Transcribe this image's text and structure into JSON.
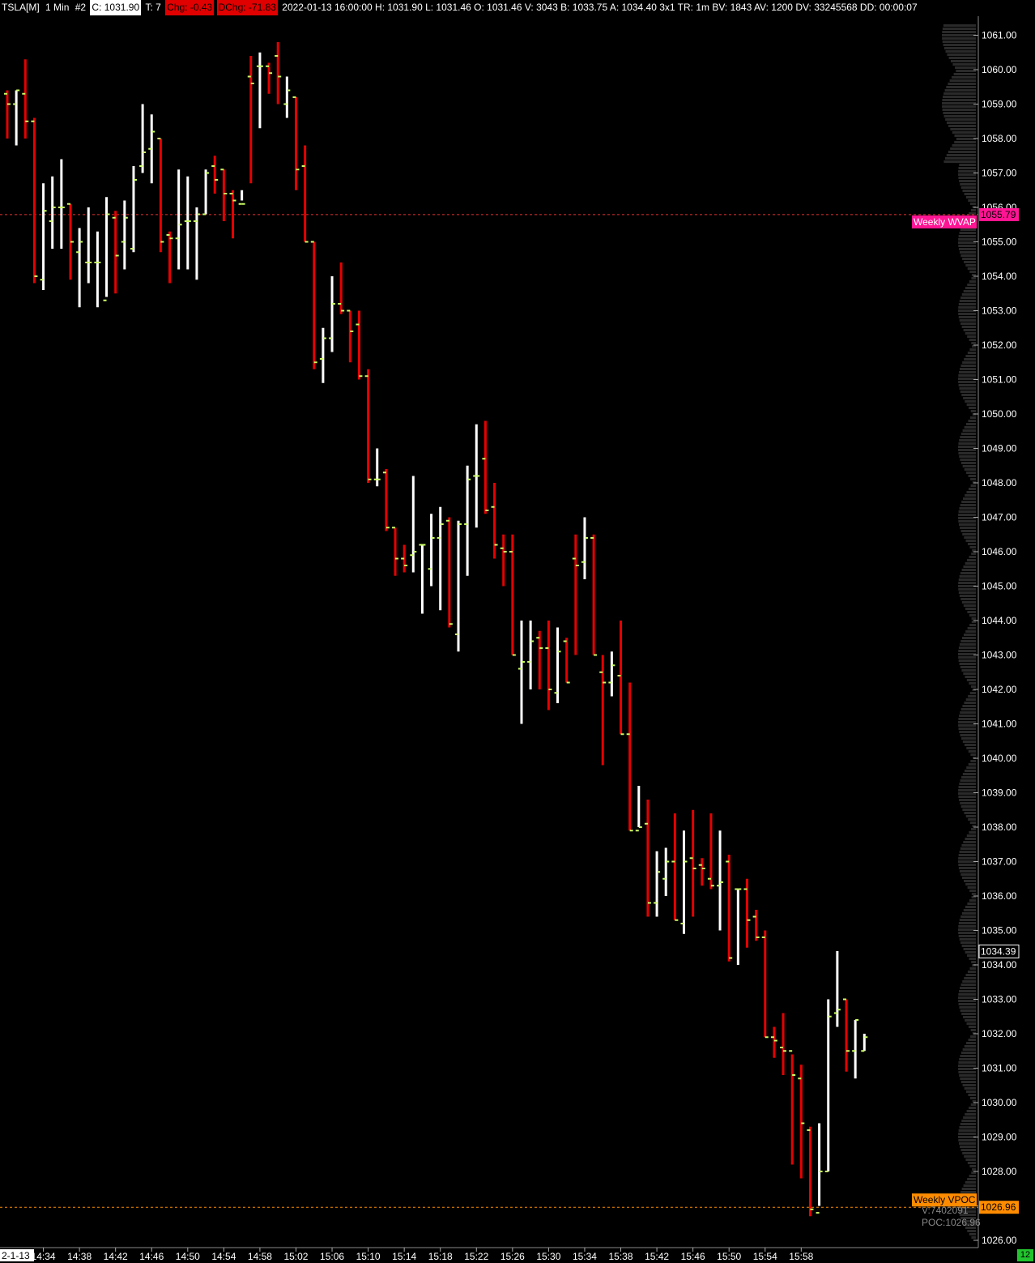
{
  "header": {
    "symbol": "TSLA[M]",
    "timeframe": "1 Min",
    "chart_num": "#2",
    "close": "C: 1031.90",
    "ticks": "T: 7",
    "chg": "Chg: -0.43",
    "dchg": "DChg: -71.83",
    "info": "2022-01-13 16:00:00 H: 1031.90 L: 1031.46 O: 1031.46 V: 3043 B: 1033.75 A: 1034.40 3x1 TR: 1m BV: 1843 AV: 1200 DV: 33245568 DD: 00:00:07"
  },
  "date_label": "2-1-13",
  "badge": "12",
  "colors": {
    "up": "#ffffff",
    "down": "#e60000",
    "close_tick": "#ccff66",
    "wvap": "#ff1493",
    "vpoc": "#ff8c00"
  },
  "chart_data": {
    "type": "ohlc",
    "ylim": [
      1025.8,
      1061.6
    ],
    "yticks": [
      1026,
      1027,
      1028,
      1029,
      1030,
      1031,
      1032,
      1033,
      1034,
      1035,
      1036,
      1037,
      1038,
      1039,
      1040,
      1041,
      1042,
      1043,
      1044,
      1045,
      1046,
      1047,
      1048,
      1049,
      1050,
      1051,
      1052,
      1053,
      1054,
      1055,
      1056,
      1057,
      1058,
      1059,
      1060,
      1061
    ],
    "xticks": [
      "14:34",
      "14:38",
      "14:42",
      "14:46",
      "14:50",
      "14:54",
      "14:58",
      "15:02",
      "15:06",
      "15:10",
      "15:14",
      "15:18",
      "15:22",
      "15:26",
      "15:30",
      "15:34",
      "15:38",
      "15:42",
      "15:46",
      "15:50",
      "15:54",
      "15:58"
    ],
    "bars": [
      {
        "o": 1059.3,
        "h": 1059.4,
        "l": 1058.0,
        "c": 1059.0
      },
      {
        "o": 1059.0,
        "h": 1059.4,
        "l": 1057.8,
        "c": 1059.4
      },
      {
        "o": 1059.3,
        "h": 1060.3,
        "l": 1058.0,
        "c": 1058.5
      },
      {
        "o": 1058.5,
        "h": 1058.6,
        "l": 1053.8,
        "c": 1054.0
      },
      {
        "o": 1053.9,
        "h": 1056.7,
        "l": 1053.6,
        "c": 1055.9
      },
      {
        "o": 1055.6,
        "h": 1056.9,
        "l": 1054.8,
        "c": 1056.0
      },
      {
        "o": 1056.0,
        "h": 1057.4,
        "l": 1054.8,
        "c": 1056.0
      },
      {
        "o": 1056.1,
        "h": 1056.1,
        "l": 1053.9,
        "c": 1055.0
      },
      {
        "o": 1054.7,
        "h": 1055.4,
        "l": 1053.1,
        "c": 1055.0
      },
      {
        "o": 1054.4,
        "h": 1056.0,
        "l": 1053.8,
        "c": 1054.4
      },
      {
        "o": 1054.4,
        "h": 1055.3,
        "l": 1053.1,
        "c": 1054.4
      },
      {
        "o": 1053.3,
        "h": 1056.3,
        "l": 1053.4,
        "c": 1055.8
      },
      {
        "o": 1055.7,
        "h": 1055.9,
        "l": 1053.5,
        "c": 1054.6
      },
      {
        "o": 1055.0,
        "h": 1056.2,
        "l": 1054.2,
        "c": 1055.7
      },
      {
        "o": 1054.8,
        "h": 1057.2,
        "l": 1054.7,
        "c": 1056.8
      },
      {
        "o": 1057.2,
        "h": 1059.0,
        "l": 1057.0,
        "c": 1057.6
      },
      {
        "o": 1057.7,
        "h": 1058.7,
        "l": 1056.7,
        "c": 1058.2
      },
      {
        "o": 1058.0,
        "h": 1058.0,
        "l": 1054.7,
        "c": 1055.0
      },
      {
        "o": 1055.2,
        "h": 1055.3,
        "l": 1053.8,
        "c": 1055.1
      },
      {
        "o": 1055.1,
        "h": 1057.1,
        "l": 1054.2,
        "c": 1055.5
      },
      {
        "o": 1055.6,
        "h": 1056.9,
        "l": 1054.2,
        "c": 1055.6
      },
      {
        "o": 1055.6,
        "h": 1056.0,
        "l": 1053.9,
        "c": 1055.8
      },
      {
        "o": 1055.8,
        "h": 1057.1,
        "l": 1055.8,
        "c": 1057.0
      },
      {
        "o": 1057.2,
        "h": 1057.5,
        "l": 1056.4,
        "c": 1056.8
      },
      {
        "o": 1057.1,
        "h": 1057.1,
        "l": 1055.6,
        "c": 1056.4
      },
      {
        "o": 1056.4,
        "h": 1056.5,
        "l": 1055.1,
        "c": 1056.2
      },
      {
        "o": 1056.1,
        "h": 1056.5,
        "l": 1056.2,
        "c": 1056.1
      },
      {
        "o": 1059.8,
        "h": 1060.4,
        "l": 1056.7,
        "c": 1059.6
      },
      {
        "o": 1060.1,
        "h": 1060.5,
        "l": 1058.3,
        "c": 1060.1
      },
      {
        "o": 1060.1,
        "h": 1060.2,
        "l": 1059.3,
        "c": 1059.9
      },
      {
        "o": 1060.4,
        "h": 1060.8,
        "l": 1059.0,
        "c": 1059.8
      },
      {
        "o": 1059.0,
        "h": 1059.8,
        "l": 1058.6,
        "c": 1059.4
      },
      {
        "o": 1059.2,
        "h": 1059.2,
        "l": 1056.5,
        "c": 1057.1
      },
      {
        "o": 1057.2,
        "h": 1057.8,
        "l": 1055.0,
        "c": 1055.0
      },
      {
        "o": 1055.0,
        "h": 1055.0,
        "l": 1051.3,
        "c": 1051.5
      },
      {
        "o": 1051.6,
        "h": 1052.5,
        "l": 1050.9,
        "c": 1052.2
      },
      {
        "o": 1052.2,
        "h": 1054.0,
        "l": 1051.8,
        "c": 1053.2
      },
      {
        "o": 1053.2,
        "h": 1054.4,
        "l": 1052.9,
        "c": 1053.0
      },
      {
        "o": 1053.0,
        "h": 1053.0,
        "l": 1051.5,
        "c": 1052.4
      },
      {
        "o": 1052.6,
        "h": 1053.0,
        "l": 1051.0,
        "c": 1051.1
      },
      {
        "o": 1051.1,
        "h": 1051.3,
        "l": 1048.0,
        "c": 1048.1
      },
      {
        "o": 1048.1,
        "h": 1049.0,
        "l": 1047.9,
        "c": 1048.1
      },
      {
        "o": 1048.3,
        "h": 1048.4,
        "l": 1046.6,
        "c": 1046.7
      },
      {
        "o": 1046.7,
        "h": 1046.7,
        "l": 1045.3,
        "c": 1045.8
      },
      {
        "o": 1045.8,
        "h": 1046.2,
        "l": 1045.4,
        "c": 1045.6
      },
      {
        "o": 1045.9,
        "h": 1048.2,
        "l": 1045.4,
        "c": 1046.0
      },
      {
        "o": 1046.2,
        "h": 1046.2,
        "l": 1044.2,
        "c": 1046.2
      },
      {
        "o": 1045.5,
        "h": 1047.1,
        "l": 1045.0,
        "c": 1046.4
      },
      {
        "o": 1046.4,
        "h": 1047.3,
        "l": 1044.3,
        "c": 1046.8
      },
      {
        "o": 1046.9,
        "h": 1047.0,
        "l": 1043.8,
        "c": 1043.9
      },
      {
        "o": 1043.6,
        "h": 1046.9,
        "l": 1043.1,
        "c": 1046.8
      },
      {
        "o": 1046.8,
        "h": 1048.5,
        "l": 1045.3,
        "c": 1048.1
      },
      {
        "o": 1048.2,
        "h": 1049.7,
        "l": 1046.7,
        "c": 1048.2
      },
      {
        "o": 1048.7,
        "h": 1049.8,
        "l": 1047.1,
        "c": 1047.2
      },
      {
        "o": 1047.3,
        "h": 1048.0,
        "l": 1045.8,
        "c": 1046.2
      },
      {
        "o": 1046.1,
        "h": 1046.5,
        "l": 1045.0,
        "c": 1046.0
      },
      {
        "o": 1046.0,
        "h": 1046.5,
        "l": 1043.0,
        "c": 1043.0
      },
      {
        "o": 1042.6,
        "h": 1044.0,
        "l": 1041.0,
        "c": 1042.8
      },
      {
        "o": 1042.8,
        "h": 1044.0,
        "l": 1042.0,
        "c": 1043.4
      },
      {
        "o": 1043.5,
        "h": 1043.7,
        "l": 1042.0,
        "c": 1043.2
      },
      {
        "o": 1043.2,
        "h": 1044.0,
        "l": 1041.4,
        "c": 1042.0
      },
      {
        "o": 1041.9,
        "h": 1043.8,
        "l": 1041.6,
        "c": 1043.1
      },
      {
        "o": 1043.4,
        "h": 1043.5,
        "l": 1042.2,
        "c": 1042.2
      },
      {
        "o": 1045.8,
        "h": 1046.5,
        "l": 1043.0,
        "c": 1045.6
      },
      {
        "o": 1045.7,
        "h": 1047.0,
        "l": 1045.2,
        "c": 1046.4
      },
      {
        "o": 1046.4,
        "h": 1046.5,
        "l": 1043.0,
        "c": 1043.0
      },
      {
        "o": 1042.5,
        "h": 1043.0,
        "l": 1039.8,
        "c": 1042.2
      },
      {
        "o": 1042.2,
        "h": 1043.1,
        "l": 1041.8,
        "c": 1042.7
      },
      {
        "o": 1042.4,
        "h": 1044.0,
        "l": 1040.7,
        "c": 1040.7
      },
      {
        "o": 1040.7,
        "h": 1042.2,
        "l": 1037.9,
        "c": 1037.9
      },
      {
        "o": 1037.9,
        "h": 1039.2,
        "l": 1038.0,
        "c": 1038.0
      },
      {
        "o": 1038.1,
        "h": 1038.8,
        "l": 1035.4,
        "c": 1035.8
      },
      {
        "o": 1035.8,
        "h": 1037.3,
        "l": 1035.4,
        "c": 1036.7
      },
      {
        "o": 1036.5,
        "h": 1037.4,
        "l": 1036.0,
        "c": 1037.0
      },
      {
        "o": 1037.0,
        "h": 1038.4,
        "l": 1035.3,
        "c": 1035.3
      },
      {
        "o": 1035.2,
        "h": 1037.9,
        "l": 1034.9,
        "c": 1037.0
      },
      {
        "o": 1037.1,
        "h": 1038.5,
        "l": 1035.4,
        "c": 1036.8
      },
      {
        "o": 1036.9,
        "h": 1037.1,
        "l": 1036.3,
        "c": 1036.8
      },
      {
        "o": 1036.5,
        "h": 1038.4,
        "l": 1036.2,
        "c": 1036.3
      },
      {
        "o": 1036.3,
        "h": 1037.9,
        "l": 1035.0,
        "c": 1036.4
      },
      {
        "o": 1037.0,
        "h": 1037.2,
        "l": 1034.1,
        "c": 1034.2
      },
      {
        "o": 1036.2,
        "h": 1036.2,
        "l": 1034.0,
        "c": 1036.2
      },
      {
        "o": 1036.2,
        "h": 1036.5,
        "l": 1034.5,
        "c": 1035.3
      },
      {
        "o": 1035.4,
        "h": 1035.6,
        "l": 1034.7,
        "c": 1034.8
      },
      {
        "o": 1034.8,
        "h": 1035.0,
        "l": 1031.9,
        "c": 1031.9
      },
      {
        "o": 1031.9,
        "h": 1032.2,
        "l": 1031.3,
        "c": 1031.8
      },
      {
        "o": 1031.6,
        "h": 1032.6,
        "l": 1030.8,
        "c": 1031.5
      },
      {
        "o": 1031.5,
        "h": 1031.4,
        "l": 1028.2,
        "c": 1030.8
      },
      {
        "o": 1030.7,
        "h": 1031.1,
        "l": 1027.8,
        "c": 1029.4
      },
      {
        "o": 1029.2,
        "h": 1029.3,
        "l": 1026.7,
        "c": 1026.9
      },
      {
        "o": 1026.8,
        "h": 1029.4,
        "l": 1027.0,
        "c": 1028.0
      },
      {
        "o": 1028.0,
        "h": 1033.0,
        "l": 1028.0,
        "c": 1032.5
      },
      {
        "o": 1032.6,
        "h": 1034.4,
        "l": 1032.2,
        "c": 1032.7
      },
      {
        "o": 1033.0,
        "h": 1033.0,
        "l": 1030.9,
        "c": 1031.5
      },
      {
        "o": 1031.5,
        "h": 1032.4,
        "l": 1030.7,
        "c": 1032.4
      },
      {
        "o": 1031.5,
        "h": 1032.0,
        "l": 1031.5,
        "c": 1031.9
      }
    ],
    "levels": [
      {
        "name": "Weekly WVAP",
        "value": 1055.79,
        "label": "1055.79"
      },
      {
        "name": "Weekly VPOC",
        "value": 1026.96,
        "label": "1026.96"
      }
    ],
    "last_price": {
      "value": 1034.39,
      "label": "1034.39"
    },
    "vpoc_info": [
      "V:7402091",
      "POC:1026.96"
    ]
  }
}
